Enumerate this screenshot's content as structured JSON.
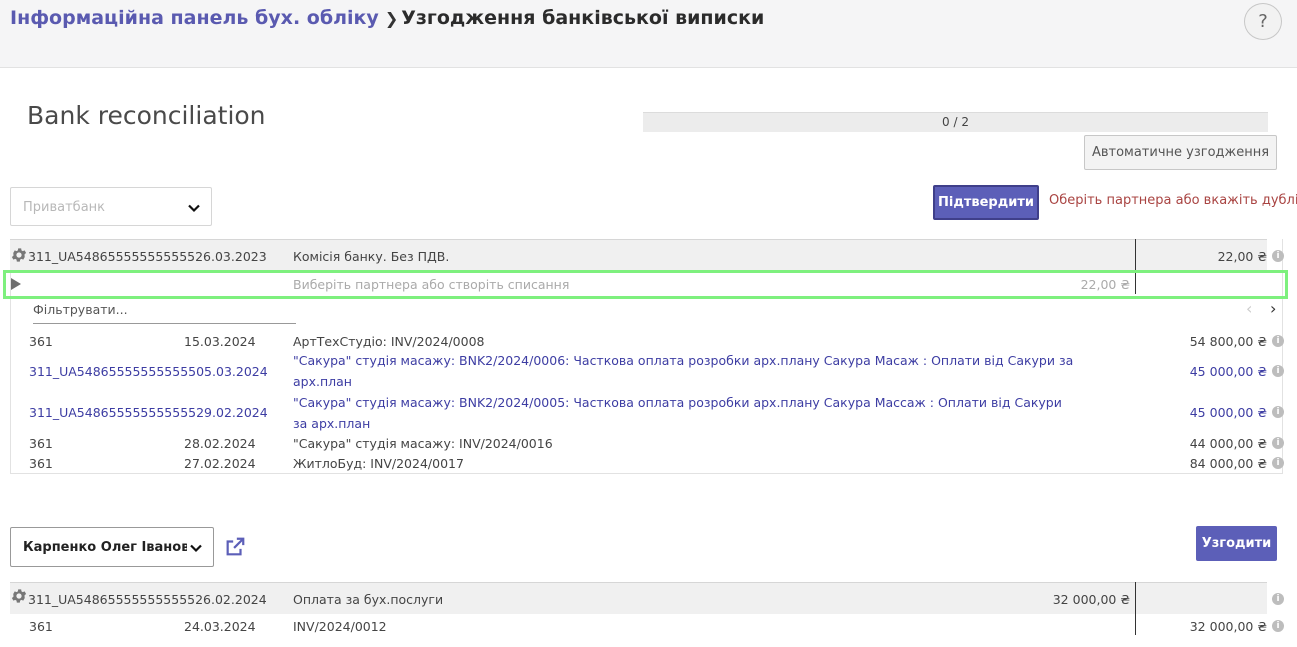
{
  "breadcrumb": {
    "parent": "Інформаційна панель бух. обліку",
    "current": "Узгодження банківської виписки"
  },
  "help_label": "?",
  "page_title": "Bank reconciliation",
  "progress": {
    "text": "0 / 2",
    "fraction": 0
  },
  "auto_button": "Автоматичне узгодження",
  "journal_select": {
    "value": "Приватбанк"
  },
  "confirm_button": "Підтвердити",
  "warning": "Оберіть партнера або вкажіть дублікат",
  "statement1": {
    "ref": "311_UA54865555555555526.03.2023",
    "label": "Комісія банку. Без ПДВ.",
    "amount": "22,00 ₴",
    "selected_line": {
      "placeholder": "Виберіть партнера або створіть списання",
      "amount": "22,00 ₴"
    },
    "filter_placeholder": "Фільтрувати...",
    "candidates": [
      {
        "account": "361",
        "date": "15.03.2024",
        "label": "АртТехСтудіо: INV/2024/0008",
        "amount": "54 800,00 ₴",
        "link": false
      },
      {
        "account": "311_UA548655555555555",
        "date": "05.03.2024",
        "label": "\"Сакура\" студія масажу: BNK2/2024/0006: Часткова оплата розробки арх.плану Сакура Масаж : Оплати від Сакури за",
        "label2": "арх.план",
        "amount": "45 000,00 ₴",
        "link": true
      },
      {
        "account": "311_UA548655555555555",
        "date": "29.02.2024",
        "label": "\"Сакура\" студія масажу: BNK2/2024/0005: Часткова оплата розробки арх.плану Сакура Массаж : Оплати від Сакури",
        "label2": "за арх.план",
        "amount": "45 000,00 ₴",
        "link": true
      },
      {
        "account": "361",
        "date": "28.02.2024",
        "label": "\"Сакура\" студія масажу: INV/2024/0016",
        "amount": "44 000,00 ₴",
        "link": false
      },
      {
        "account": "361",
        "date": "27.02.2024",
        "label": "ЖитлоБуд: INV/2024/0017",
        "amount": "84 000,00 ₴",
        "link": false
      }
    ]
  },
  "partner_select": {
    "value": "Карпенко Олег Іванович"
  },
  "match_button": "Узгодити",
  "statement2": {
    "ref": "311_UA54865555555555526.02.2024",
    "label": "Оплата за бух.послуги",
    "amount": "32 000,00 ₴",
    "line": {
      "account": "361",
      "date": "24.03.2024",
      "label": "INV/2024/0012",
      "amount": "32 000,00 ₴"
    }
  },
  "colors": {
    "primary": "#5c5fb8",
    "warning": "#a94442",
    "highlight": "#7ef07e",
    "link": "#3d3da3"
  }
}
